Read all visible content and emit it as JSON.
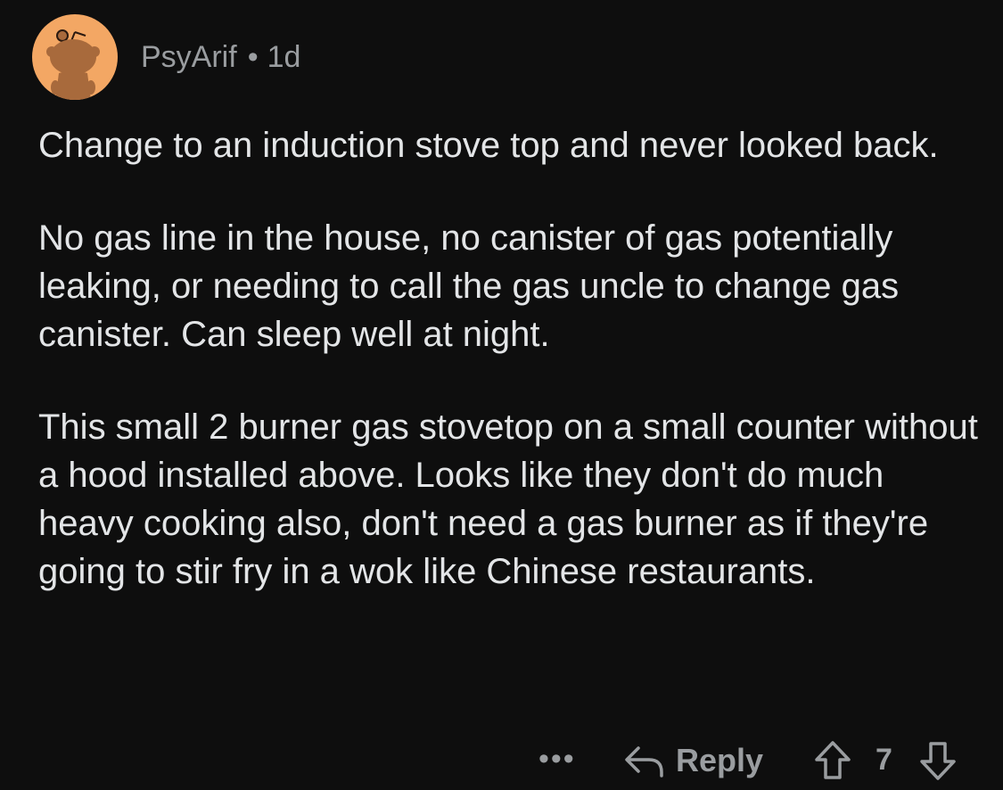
{
  "comment": {
    "author": "PsyArif",
    "separator": "•",
    "age": "1d",
    "paragraphs": [
      "Change to an induction stove top and never looked back.",
      "No gas line in the house, no canister of gas potentially leaking, or needing to call the gas uncle to change gas canister. Can sleep well at night.",
      "This small 2 burner gas stovetop on a small counter without a hood installed above. Looks like they don't do much heavy cooking also, don't need a gas burner as if they're going to stir fry in a wok like Chinese restaurants."
    ]
  },
  "actions": {
    "more_label": "•••",
    "reply_label": "Reply",
    "score": "7"
  },
  "icons": {
    "avatar": "default-snoo-avatar",
    "more": "more-options-icon",
    "reply": "reply-arrow-icon",
    "upvote": "upvote-arrow-icon",
    "downvote": "downvote-arrow-icon"
  },
  "colors": {
    "background": "#0e0e0e",
    "avatar_bg": "#f3a764",
    "text": "#e3e5e7",
    "meta": "#9a9da0"
  }
}
